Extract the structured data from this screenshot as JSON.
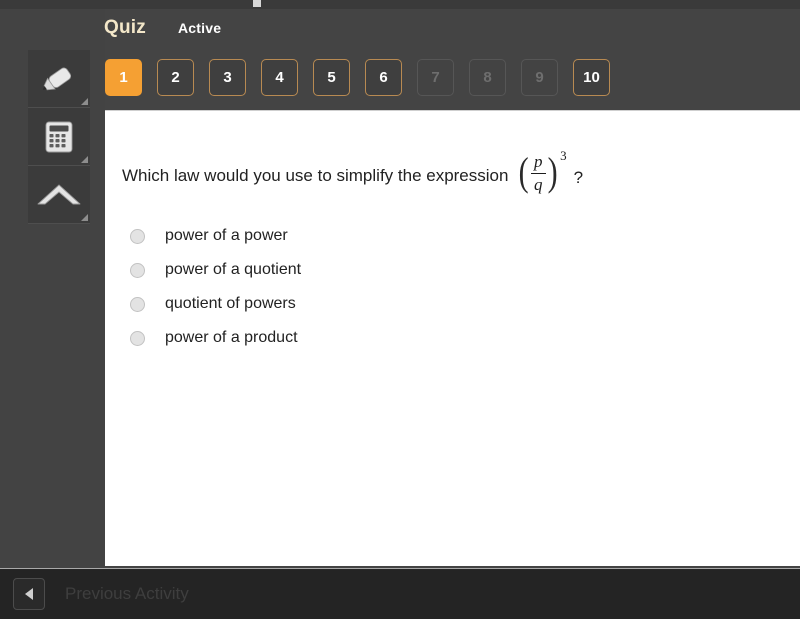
{
  "header": {
    "title": "Quiz",
    "status": "Active"
  },
  "tools": [
    {
      "name": "highlighter-tool",
      "icon": "highlighter-icon"
    },
    {
      "name": "calculator-tool",
      "icon": "calculator-icon"
    },
    {
      "name": "eraser-tool",
      "icon": "eraser-icon"
    }
  ],
  "question_nav": {
    "buttons": [
      {
        "label": "1",
        "state": "active"
      },
      {
        "label": "2",
        "state": "available"
      },
      {
        "label": "3",
        "state": "available"
      },
      {
        "label": "4",
        "state": "available"
      },
      {
        "label": "5",
        "state": "available"
      },
      {
        "label": "6",
        "state": "available"
      },
      {
        "label": "7",
        "state": "disabled"
      },
      {
        "label": "8",
        "state": "disabled"
      },
      {
        "label": "9",
        "state": "disabled"
      },
      {
        "label": "10",
        "state": "available"
      }
    ]
  },
  "question": {
    "text": "Which law would you use to simplify the expression",
    "expression": {
      "left_paren": "(",
      "numerator": "p",
      "denominator": "q",
      "right_paren": ")",
      "exponent": "3"
    },
    "trailing": "?"
  },
  "options": [
    {
      "label": "power of a power",
      "selected": false
    },
    {
      "label": "power of a quotient",
      "selected": false
    },
    {
      "label": "quotient of powers",
      "selected": false
    },
    {
      "label": "power of a product",
      "selected": false
    }
  ],
  "footer": {
    "previous_label": "Previous Activity"
  },
  "colors": {
    "accent_orange": "#f5a033",
    "title_cream": "#f3e7c9",
    "header_bg": "#444444",
    "panel_bg": "#ffffff",
    "footer_bg": "#242424"
  }
}
